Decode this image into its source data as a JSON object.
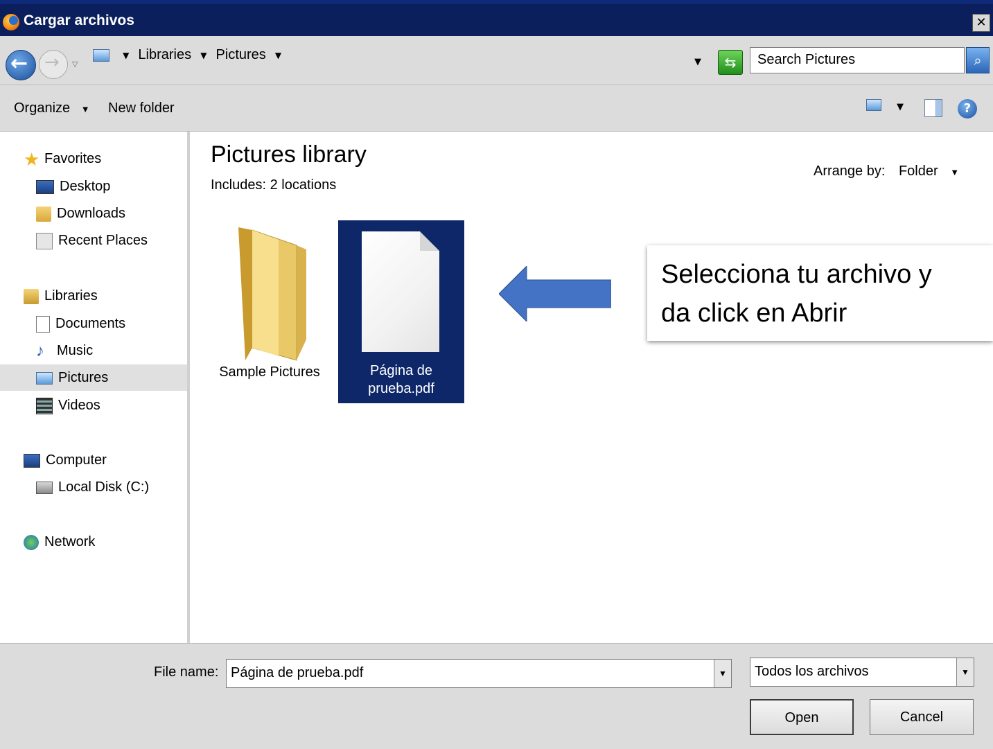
{
  "window": {
    "title": "Cargar archivos"
  },
  "address_bar": {
    "crumbs": [
      "Libraries",
      "Pictures"
    ],
    "search_placeholder": "Search Pictures"
  },
  "toolbar": {
    "organize": "Organize",
    "new_folder": "New folder"
  },
  "sidebar": {
    "favorites": {
      "label": "Favorites",
      "items": [
        "Desktop",
        "Downloads",
        "Recent Places"
      ]
    },
    "libraries": {
      "label": "Libraries",
      "items": [
        "Documents",
        "Music",
        "Pictures",
        "Videos"
      ]
    },
    "computer": {
      "label": "Computer",
      "items": [
        "Local Disk (C:)"
      ]
    },
    "network": {
      "label": "Network"
    },
    "selected": "Pictures"
  },
  "main": {
    "title": "Pictures library",
    "includes": "Includes:  2 locations",
    "arrange_label": "Arrange by:",
    "arrange_value": "Folder",
    "files": [
      {
        "name": "Sample Pictures",
        "type": "folder"
      },
      {
        "name_line1": "Página de",
        "name_line2": "prueba.pdf",
        "type": "pdf",
        "selected": true
      }
    ]
  },
  "annotation": {
    "line1": "Selecciona tu archivo y",
    "line2": "da click en Abrir",
    "arrow_color": "#4472c4"
  },
  "footer": {
    "file_name_label": "File name:",
    "file_name_value": "Página de prueba.pdf",
    "file_type": "Todos los archivos",
    "open": "Open",
    "cancel": "Cancel"
  },
  "colors": {
    "title_bar": "#0a1f5c",
    "selection": "#0d2769",
    "chrome": "#dcdcdc"
  }
}
